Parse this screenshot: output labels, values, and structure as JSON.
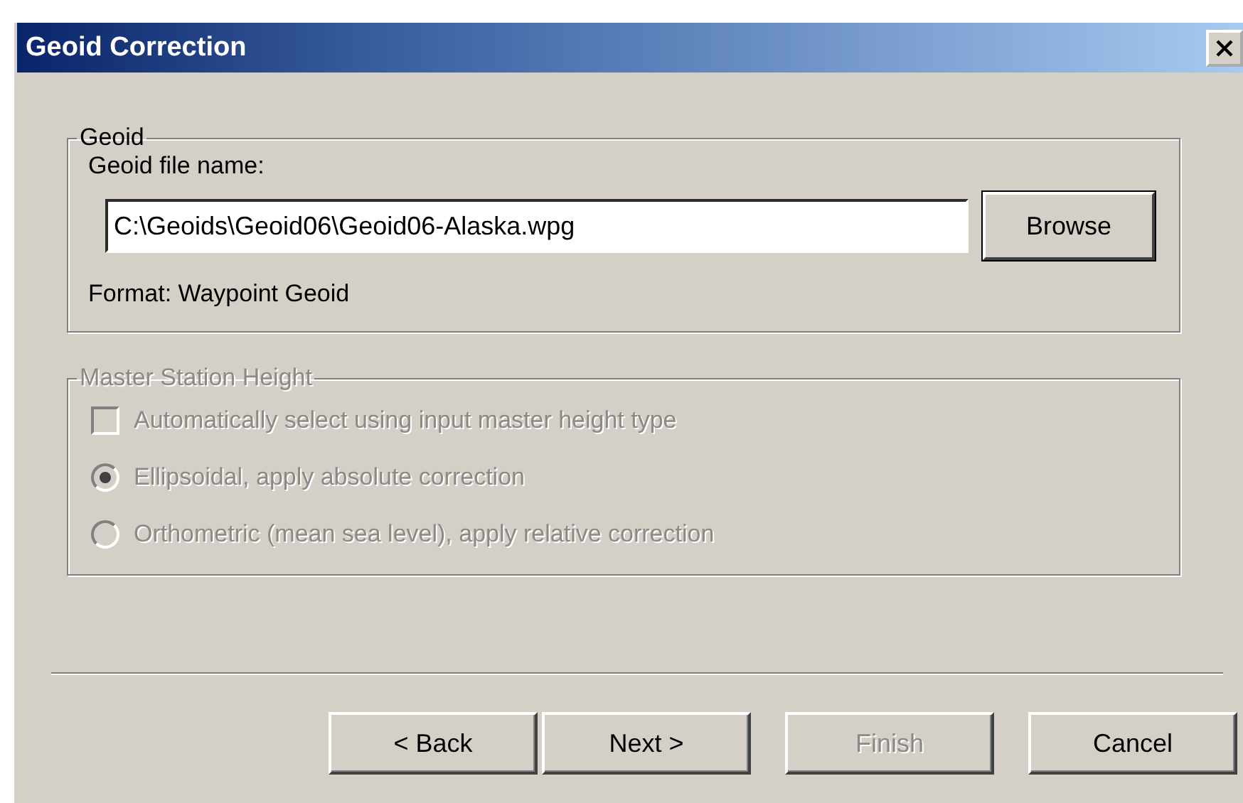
{
  "window": {
    "title": "Geoid Correction"
  },
  "geoid": {
    "legend": "Geoid",
    "file_label": "Geoid file name:",
    "file_value": "C:\\Geoids\\Geoid06\\Geoid06-Alaska.wpg",
    "browse": "Browse",
    "format": "Format: Waypoint Geoid"
  },
  "master": {
    "legend": "Master Station Height",
    "disabled": true,
    "options": [
      {
        "kind": "checkbox",
        "label": "Automatically select using input master height type",
        "checked": false
      },
      {
        "kind": "radio",
        "label": "Ellipsoidal, apply absolute correction",
        "selected": true
      },
      {
        "kind": "radio",
        "label": "Orthometric (mean sea level), apply relative correction",
        "selected": false
      }
    ]
  },
  "buttons": [
    {
      "label": "< Back",
      "disabled": false
    },
    {
      "label": "Next >",
      "disabled": false
    },
    {
      "label": "Finish",
      "disabled": true
    },
    {
      "label": "Cancel",
      "disabled": false
    }
  ]
}
